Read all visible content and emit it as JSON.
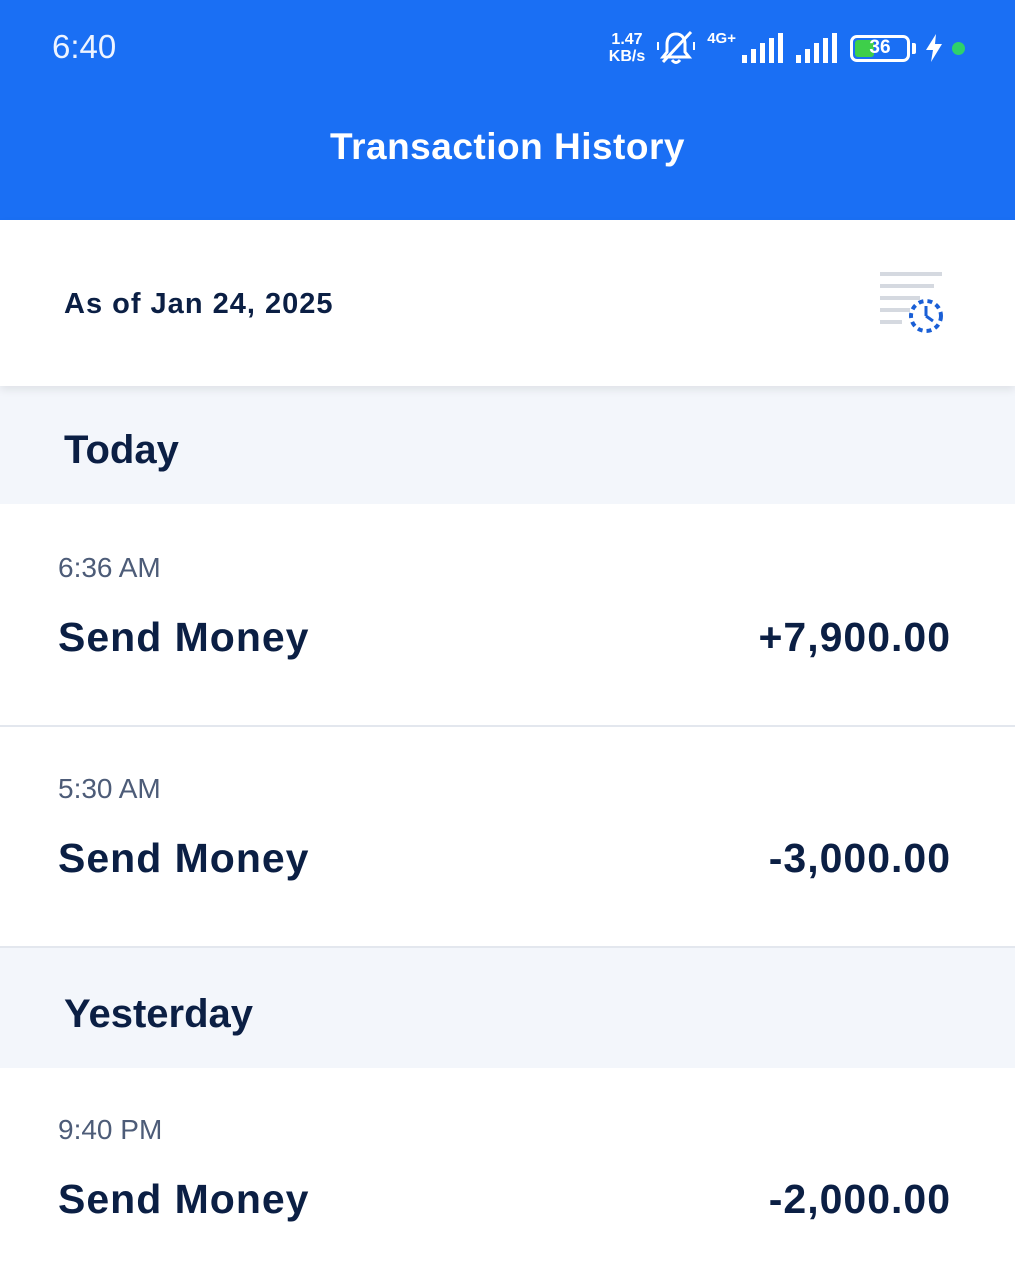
{
  "status_bar": {
    "time": "6:40",
    "net_speed_value": "1.47",
    "net_speed_unit": "KB/s",
    "network_label": "4G+",
    "battery_level": "36",
    "battery_percent": 36
  },
  "header": {
    "title": "Transaction History"
  },
  "as_of": {
    "label": "As of Jan 24, 2025"
  },
  "sections": [
    {
      "label": "Today",
      "transactions": [
        {
          "time": "6:36 AM",
          "title": "Send Money",
          "amount": "+7,900.00"
        },
        {
          "time": "5:30 AM",
          "title": "Send Money",
          "amount": "-3,000.00"
        }
      ]
    },
    {
      "label": "Yesterday",
      "transactions": [
        {
          "time": "9:40 PM",
          "title": "Send Money",
          "amount": "-2,000.00"
        }
      ]
    }
  ],
  "colors": {
    "header_blue": "#1a6ff4",
    "section_bg": "#f3f6fb",
    "text_dark": "#0b1f44",
    "battery_green": "#3ecf4a"
  }
}
